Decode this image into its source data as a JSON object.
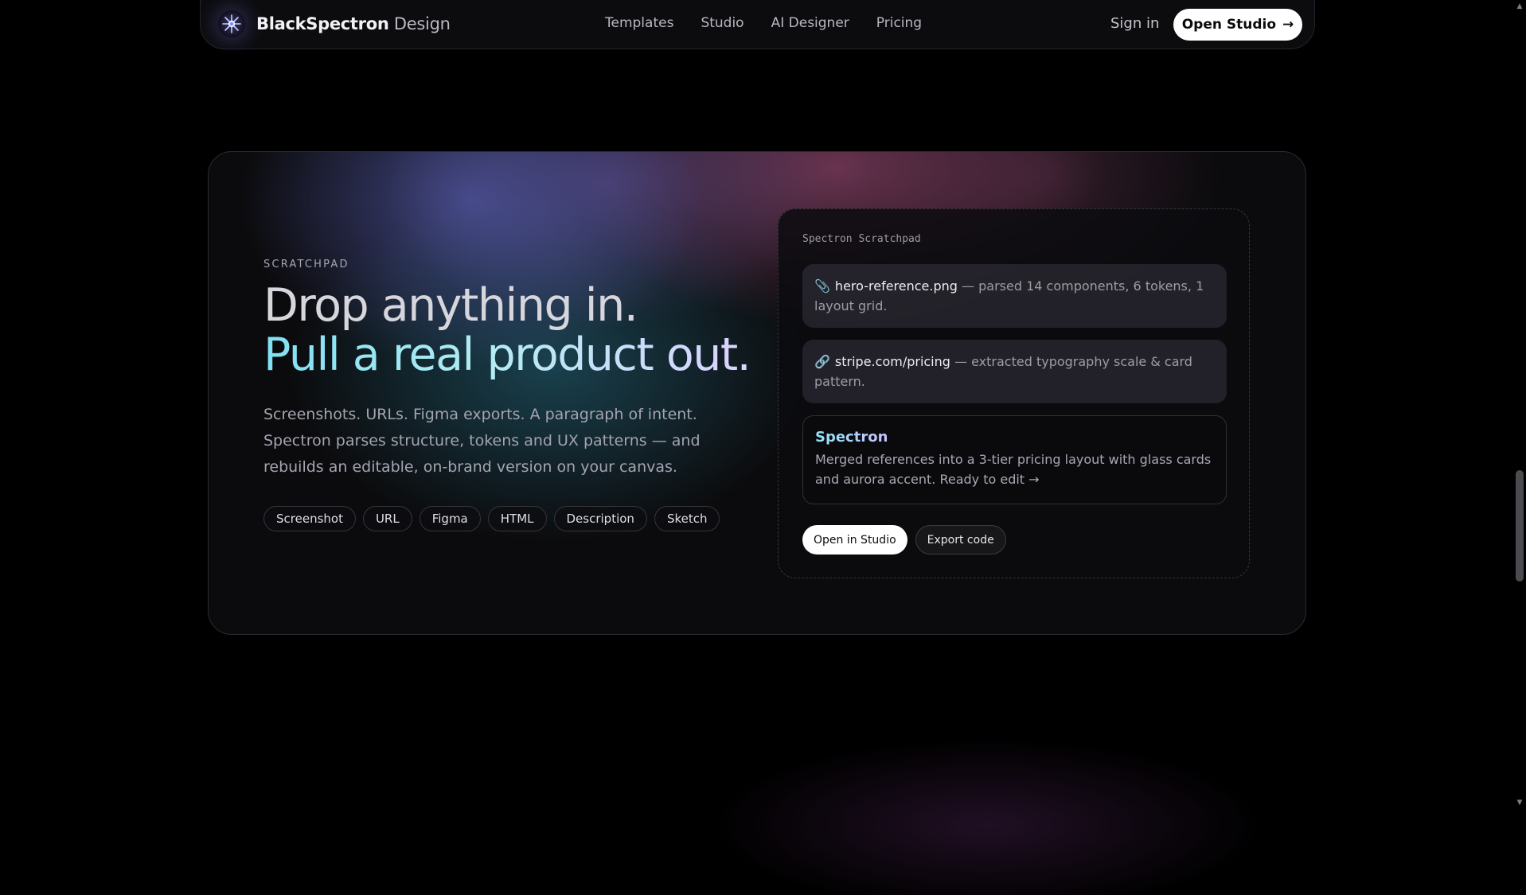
{
  "nav": {
    "brand_name": "BlackSpectron",
    "brand_suffix": "Design",
    "links": [
      "Templates",
      "Studio",
      "AI Designer",
      "Pricing"
    ],
    "signin_label": "Sign in",
    "cta_label": "Open Studio",
    "cta_arrow": "→"
  },
  "hero": {
    "eyebrow": "SCRATCHPAD",
    "headline_line1": "Drop anything in.",
    "headline_line2": "Pull a real product out.",
    "lede": "Screenshots. URLs. Figma exports. A paragraph of intent. Spectron parses structure, tokens and UX patterns — and rebuilds an editable, on-brand version on your canvas.",
    "chips": [
      "Screenshot",
      "URL",
      "Figma",
      "HTML",
      "Description",
      "Sketch"
    ]
  },
  "scratchpad": {
    "title": "Spectron Scratchpad",
    "references": [
      {
        "icon": "paperclip-icon",
        "glyph": "📎",
        "name": "hero-reference.png",
        "detail": "— parsed 14 components, 6 tokens, 1 layout grid."
      },
      {
        "icon": "link-icon",
        "glyph": "🔗",
        "name": "stripe.com/pricing",
        "detail": "— extracted typography scale & card pattern."
      }
    ],
    "reply": {
      "author": "Spectron",
      "text": "Merged references into a 3-tier pricing layout with glass cards and aurora accent. Ready to edit →"
    },
    "actions": {
      "primary": "Open in Studio",
      "secondary": "Export code"
    }
  },
  "colors": {
    "background": "#000000",
    "card_background": "#0b0b0d",
    "accent_cyan": "#7fe0f4",
    "accent_lavender": "#dcd2ff",
    "aurora_blue": "#6068c4",
    "aurora_pink": "#be588c",
    "aurora_teal": "#2e8ca8"
  },
  "scrollbar": {
    "up_glyph": "▲",
    "down_glyph": "▼"
  }
}
